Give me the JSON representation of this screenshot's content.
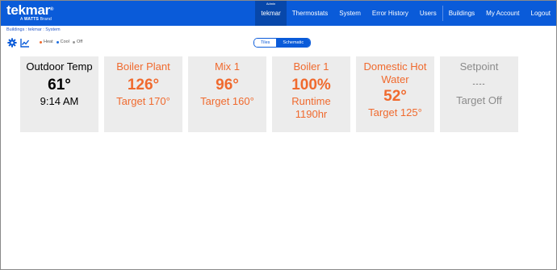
{
  "brand": {
    "name": "tekmar",
    "registered": "®",
    "tagline_prefix": "A",
    "tagline_brand": "WATTS",
    "tagline_suffix": "Brand"
  },
  "nav": {
    "items": [
      {
        "label": "tekmar",
        "tag": "Admin",
        "active": true
      },
      {
        "label": "Thermostats"
      },
      {
        "label": "System"
      },
      {
        "label": "Error History"
      },
      {
        "label": "Users"
      },
      {
        "label": "Buildings"
      },
      {
        "label": "My Account"
      },
      {
        "label": "Logout"
      }
    ]
  },
  "breadcrumb": "Buildings : tekmar : System",
  "toolbar": {
    "icons": [
      "gear-icon",
      "chart-icon"
    ],
    "legend": [
      {
        "label": "Heat",
        "color": "#f06a2e"
      },
      {
        "label": "Cool",
        "color": "#1f6fe0"
      },
      {
        "label": "Off",
        "color": "#999999"
      }
    ]
  },
  "view_toggle": {
    "tiles": "Tiles",
    "schematic": "Schematic",
    "selected": "Schematic"
  },
  "tiles": [
    {
      "title": "Outdoor Temp",
      "value": "61°",
      "line1": "9:14 AM",
      "color": "#000000"
    },
    {
      "title": "Boiler Plant",
      "value": "126°",
      "line1": "Target 170°",
      "color": "#f06a2e"
    },
    {
      "title": "Mix 1",
      "value": "96°",
      "line1": "Target 160°",
      "color": "#f06a2e"
    },
    {
      "title": "Boiler 1",
      "value": "100%",
      "line1": "Runtime",
      "line2": "1190hr",
      "color": "#f06a2e"
    },
    {
      "title": "Domestic Hot",
      "title2": "Water",
      "value": "52°",
      "line1": "Target 125°",
      "color": "#f06a2e"
    },
    {
      "title": "Setpoint",
      "value": "----",
      "line1": "Target Off",
      "color": "#8b8b8b"
    }
  ]
}
